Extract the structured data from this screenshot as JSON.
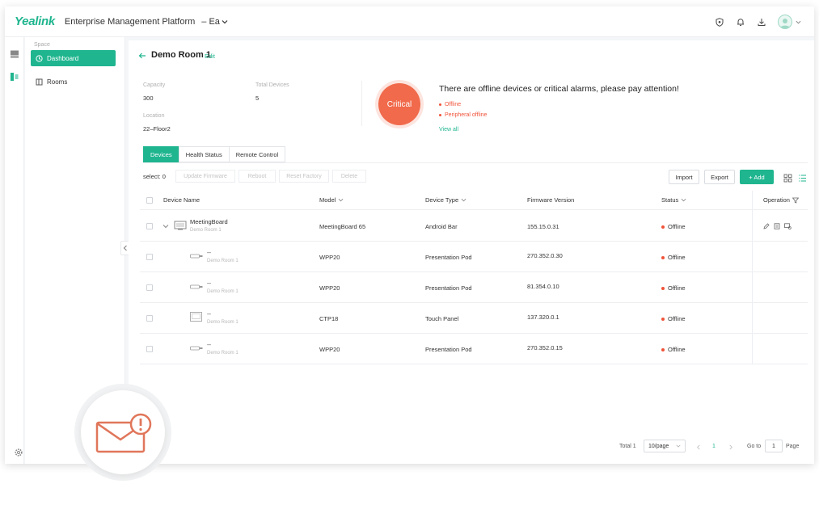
{
  "header": {
    "logo": "Yealink",
    "title": "Enterprise Management Platform",
    "org": "– Ea"
  },
  "sidebar": {
    "section_label": "Space",
    "items": [
      {
        "label": "Dashboard",
        "icon": "dashboard-icon",
        "active": true
      },
      {
        "label": "Rooms",
        "icon": "rooms-icon",
        "active": false
      }
    ]
  },
  "room": {
    "title": "Demo Room 1",
    "edit_label": "Edit",
    "capacity_label": "Capacity",
    "capacity_value": "300",
    "total_devices_label": "Total Devices",
    "total_devices_value": "5",
    "location_label": "Location",
    "location_value": "22–Floor2"
  },
  "alert": {
    "level": "Critical",
    "message": "There are offline devices or critical alarms, please pay attention!",
    "items": [
      "Offline",
      "Peripheral offline"
    ],
    "view_all": "View all"
  },
  "tabs": [
    "Devices",
    "Health Status",
    "Remote Control"
  ],
  "toolbar": {
    "select_label": "select​: 0",
    "update_firmware": "Update Firmware",
    "reboot": "Reboot",
    "reset_factory": "Reset Factory",
    "delete": "Delete",
    "import": "Import",
    "export": "Export",
    "add": "+ Add"
  },
  "table": {
    "columns": [
      "Device Name",
      "Model",
      "Device Type",
      "Firmware Version",
      "Status",
      "Operation"
    ],
    "rows": [
      {
        "name": "MeetingBoard",
        "sub": "Demo Room 1",
        "model": "MeetingBoard 65",
        "type": "Android Bar",
        "firmware": "155.15.0.31",
        "status": "Offline"
      },
      {
        "name": "--",
        "sub": "Demo Room 1",
        "model": "WPP20",
        "type": "Presentation Pod",
        "firmware": "270.352.0.30",
        "status": "Offline"
      },
      {
        "name": "--",
        "sub": "Demo Room 1",
        "model": "WPP20",
        "type": "Presentation Pod",
        "firmware": "81.354.0.10",
        "status": "Offline"
      },
      {
        "name": "--",
        "sub": "Demo Room 1",
        "model": "CTP18",
        "type": "Touch Panel",
        "firmware": "137.320.0.1",
        "status": "Offline"
      },
      {
        "name": "--",
        "sub": "Demo Room 1",
        "model": "WPP20",
        "type": "Presentation Pod",
        "firmware": "270.352.0.15",
        "status": "Offline"
      }
    ]
  },
  "pager": {
    "total": "Total 1",
    "page_size": "10/page",
    "current": "1",
    "goto_label": "Go to",
    "goto_value": "1",
    "page_label": "Page"
  },
  "colors": {
    "accent": "#1fb58f",
    "critical": "#f06a4b",
    "offline": "#f0533a"
  }
}
